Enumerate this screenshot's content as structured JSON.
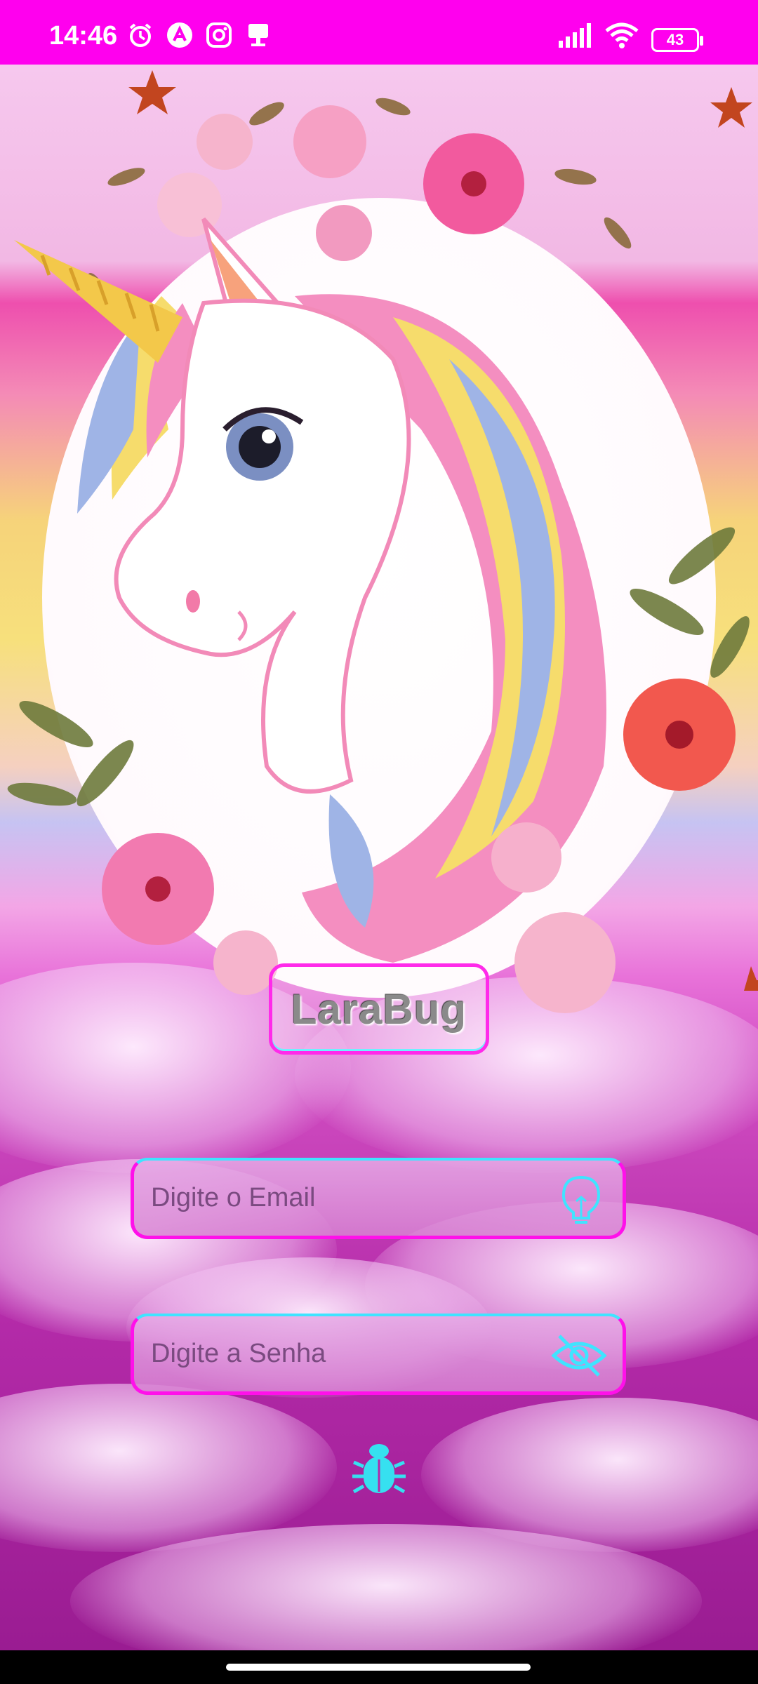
{
  "status_bar": {
    "time": "14:46",
    "battery": "43"
  },
  "app": {
    "title": "LaraBug"
  },
  "form": {
    "email_placeholder": "Digite o Email",
    "password_placeholder": "Digite a Senha"
  },
  "colors": {
    "accent_magenta": "#ff10ea",
    "accent_cyan": "#3fe4ff"
  },
  "icons": {
    "email": "lightbulb-icon",
    "password": "eye-off-icon",
    "submit": "bug-icon"
  }
}
